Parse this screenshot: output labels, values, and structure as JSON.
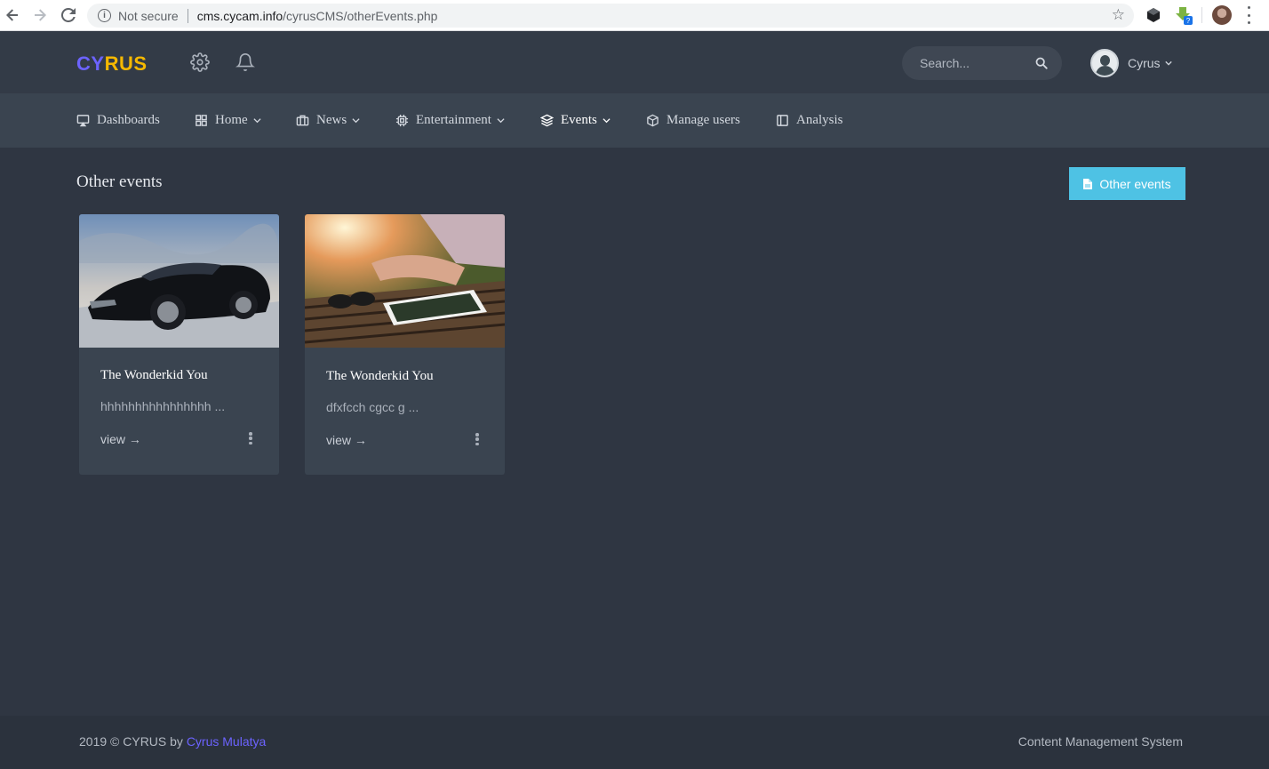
{
  "browser": {
    "security_label": "Not secure",
    "url_host": "cms.cycam.info",
    "url_path": "/cyrusCMS/otherEvents.php"
  },
  "header": {
    "logo_part1": "CY",
    "logo_part2": "RUS",
    "search_placeholder": "Search...",
    "user_name": "Cyrus"
  },
  "nav": {
    "items": [
      {
        "label": "Dashboards",
        "icon": "monitor-icon"
      },
      {
        "label": "Home",
        "icon": "grid-icon"
      },
      {
        "label": "News",
        "icon": "briefcase-icon"
      },
      {
        "label": "Entertainment",
        "icon": "cpu-icon"
      },
      {
        "label": "Events",
        "icon": "layers-icon"
      },
      {
        "label": "Manage users",
        "icon": "box-icon"
      },
      {
        "label": "Analysis",
        "icon": "sidebar-icon"
      }
    ]
  },
  "main": {
    "title": "Other events",
    "action_button": "Other events",
    "cards": [
      {
        "title": "The Wonderkid You",
        "description": "hhhhhhhhhhhhhhhh ...",
        "link": "view →"
      },
      {
        "title": "The Wonderkid You",
        "description": "dfxfcch cgcc g ...",
        "link": "view →"
      }
    ]
  },
  "footer": {
    "copyright": "2019 © CYRUS by ",
    "author": "Cyrus Mulatya",
    "tagline": "Content Management System"
  },
  "colors": {
    "background": "#2f3642",
    "header": "#333b47",
    "navbar": "#3a4450",
    "accent": "#6c63ff",
    "logo_yellow": "#f5b800",
    "button": "#4ec2e4"
  }
}
